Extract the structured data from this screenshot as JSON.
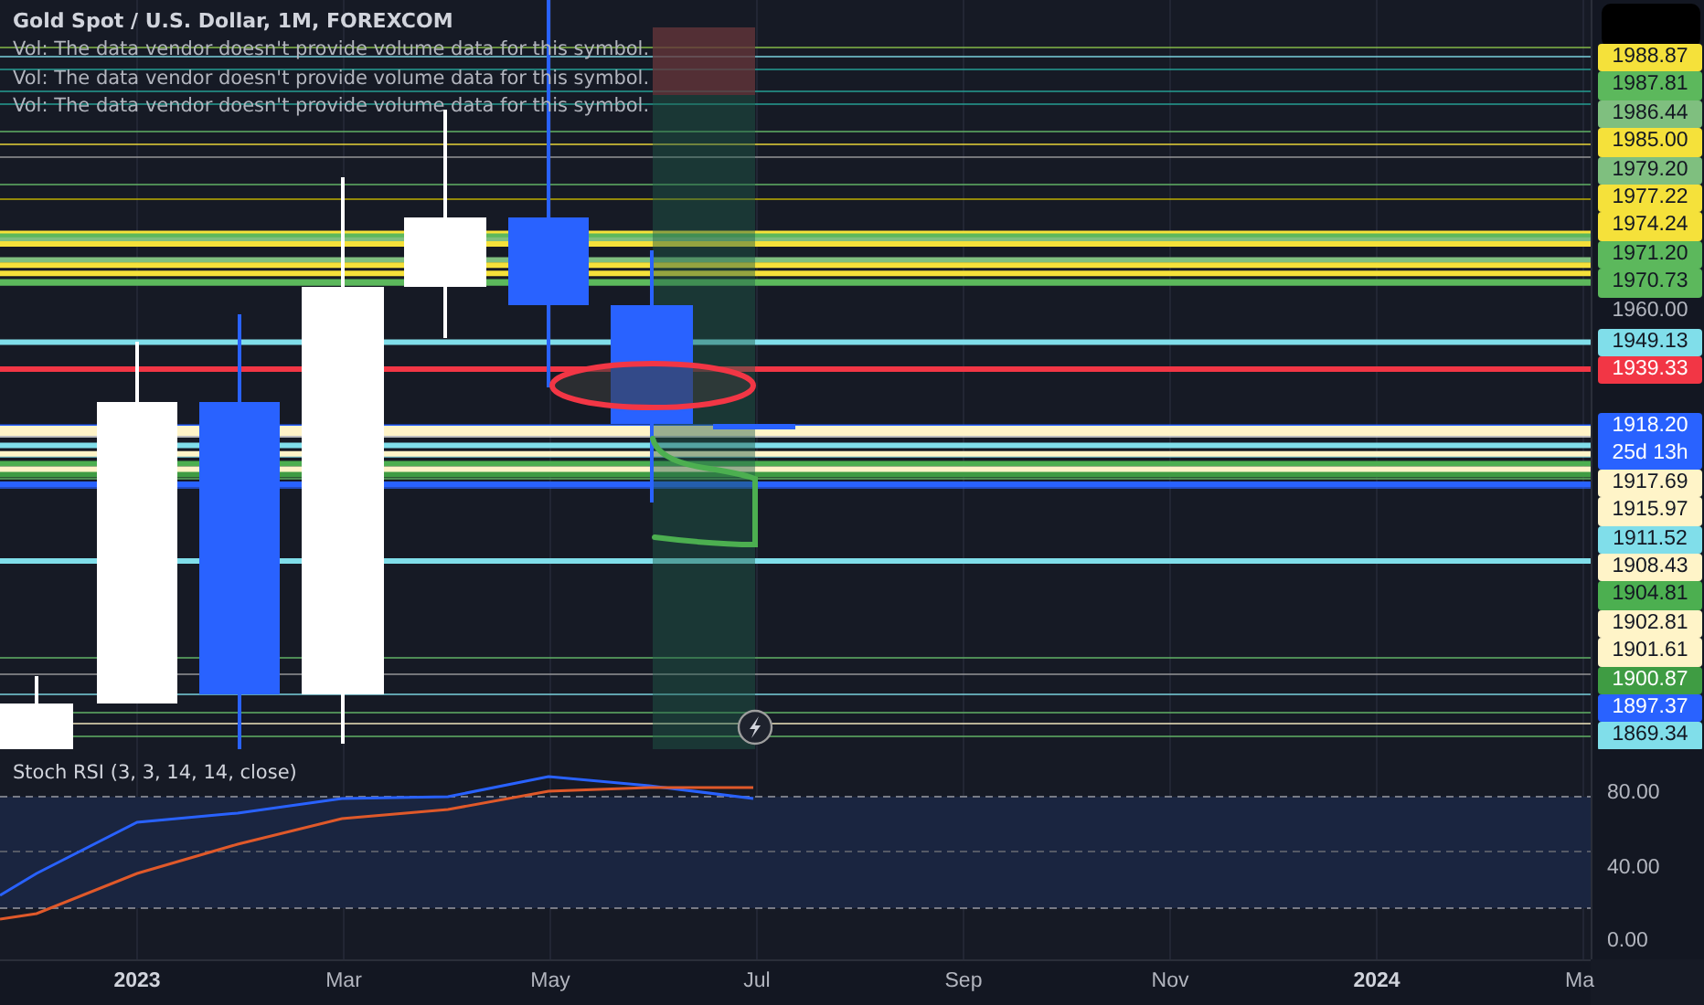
{
  "header": {
    "title": "Gold Spot / U.S. Dollar, 1M, FOREXCOM",
    "notices": [
      "Vol: The data vendor doesn't provide volume data for this symbol.",
      "Vol: The data vendor doesn't provide volume data for this symbol.",
      "Vol: The data vendor doesn't provide volume data for this symbol."
    ]
  },
  "price_scale": {
    "labels": [
      {
        "text": "1988.87",
        "kind": "line",
        "color": "#f5e13a"
      },
      {
        "text": "1987.81",
        "kind": "line",
        "color": "#5cb85c"
      },
      {
        "text": "1986.44",
        "kind": "line",
        "color": "#7fbf7f"
      },
      {
        "text": "1985.00",
        "kind": "line",
        "color": "#f5e13a"
      },
      {
        "text": "1979.20",
        "kind": "line",
        "color": "#7fbf7f"
      },
      {
        "text": "1977.22",
        "kind": "line",
        "color": "#f5e13a"
      },
      {
        "text": "1974.24",
        "kind": "line",
        "color": "#f5e13a"
      },
      {
        "text": "1971.20",
        "kind": "line",
        "color": "#5cb85c"
      },
      {
        "text": "1970.73",
        "kind": "line",
        "color": "#5cb85c"
      },
      {
        "text": "1960.00",
        "kind": "tick"
      },
      {
        "text": "1949.13",
        "kind": "line",
        "color": "#80deea"
      },
      {
        "text": "1939.33",
        "kind": "line",
        "color": "#f23645"
      },
      {
        "text": "1918.20",
        "kind": "line",
        "color": "#2962ff",
        "countdown": "25d 13h"
      },
      {
        "text": "1917.69",
        "kind": "line",
        "color": "#fff4c8"
      },
      {
        "text": "1915.97",
        "kind": "line",
        "color": "#fff4c8"
      },
      {
        "text": "1911.52",
        "kind": "line",
        "color": "#80deea"
      },
      {
        "text": "1908.43",
        "kind": "line",
        "color": "#fff4c8"
      },
      {
        "text": "1904.81",
        "kind": "line",
        "color": "#4caf50"
      },
      {
        "text": "1902.81",
        "kind": "line",
        "color": "#fff4c8"
      },
      {
        "text": "1901.61",
        "kind": "line",
        "color": "#fff4c8"
      },
      {
        "text": "1900.87",
        "kind": "line",
        "color": "#3f9c43"
      },
      {
        "text": "1897.37",
        "kind": "line",
        "color": "#2962ff"
      },
      {
        "text": "1869.34",
        "kind": "line",
        "color": "#80deea"
      }
    ]
  },
  "indicator": {
    "title": "Stoch RSI (3, 3, 14, 14, close)",
    "ticks": [
      "80.00",
      "40.00",
      "0.00"
    ]
  },
  "time_axis": [
    {
      "text": "2023",
      "bold": true
    },
    {
      "text": "Mar",
      "bold": false
    },
    {
      "text": "May",
      "bold": false
    },
    {
      "text": "Jul",
      "bold": false
    },
    {
      "text": "Sep",
      "bold": false
    },
    {
      "text": "Nov",
      "bold": false
    },
    {
      "text": "2024",
      "bold": true
    },
    {
      "text": "Ma",
      "bold": false
    }
  ]
}
